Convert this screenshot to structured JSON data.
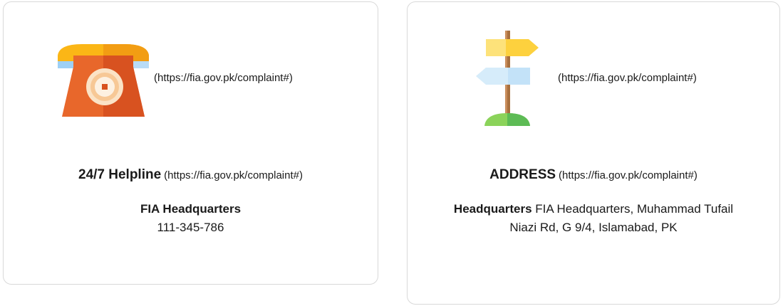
{
  "cards": [
    {
      "icon": "telephone-icon",
      "icon_link": "(https://fia.gov.pk/complaint#)",
      "title": "24/7 Helpline",
      "title_link": "(https://fia.gov.pk/complaint#)",
      "line1": "FIA Headquarters",
      "line2": "111-345-786"
    },
    {
      "icon": "signpost-icon",
      "icon_link": "(https://fia.gov.pk/complaint#)",
      "title": "ADDRESS",
      "title_link": "(https://fia.gov.pk/complaint#)",
      "label": "Headquarters",
      "address": "FIA Headquarters, Muhammad Tufail Niazi Rd, G 9/4, Islamabad, PK"
    }
  ],
  "colors": {
    "phone_body": "#e8672b",
    "phone_top": "#fbb616",
    "phone_band": "#9ed0f5",
    "sign_top": "#fdd13e",
    "sign_mid": "#d6ecfa",
    "sign_pole": "#c98d5b",
    "sign_ground": "#6bc45a"
  }
}
